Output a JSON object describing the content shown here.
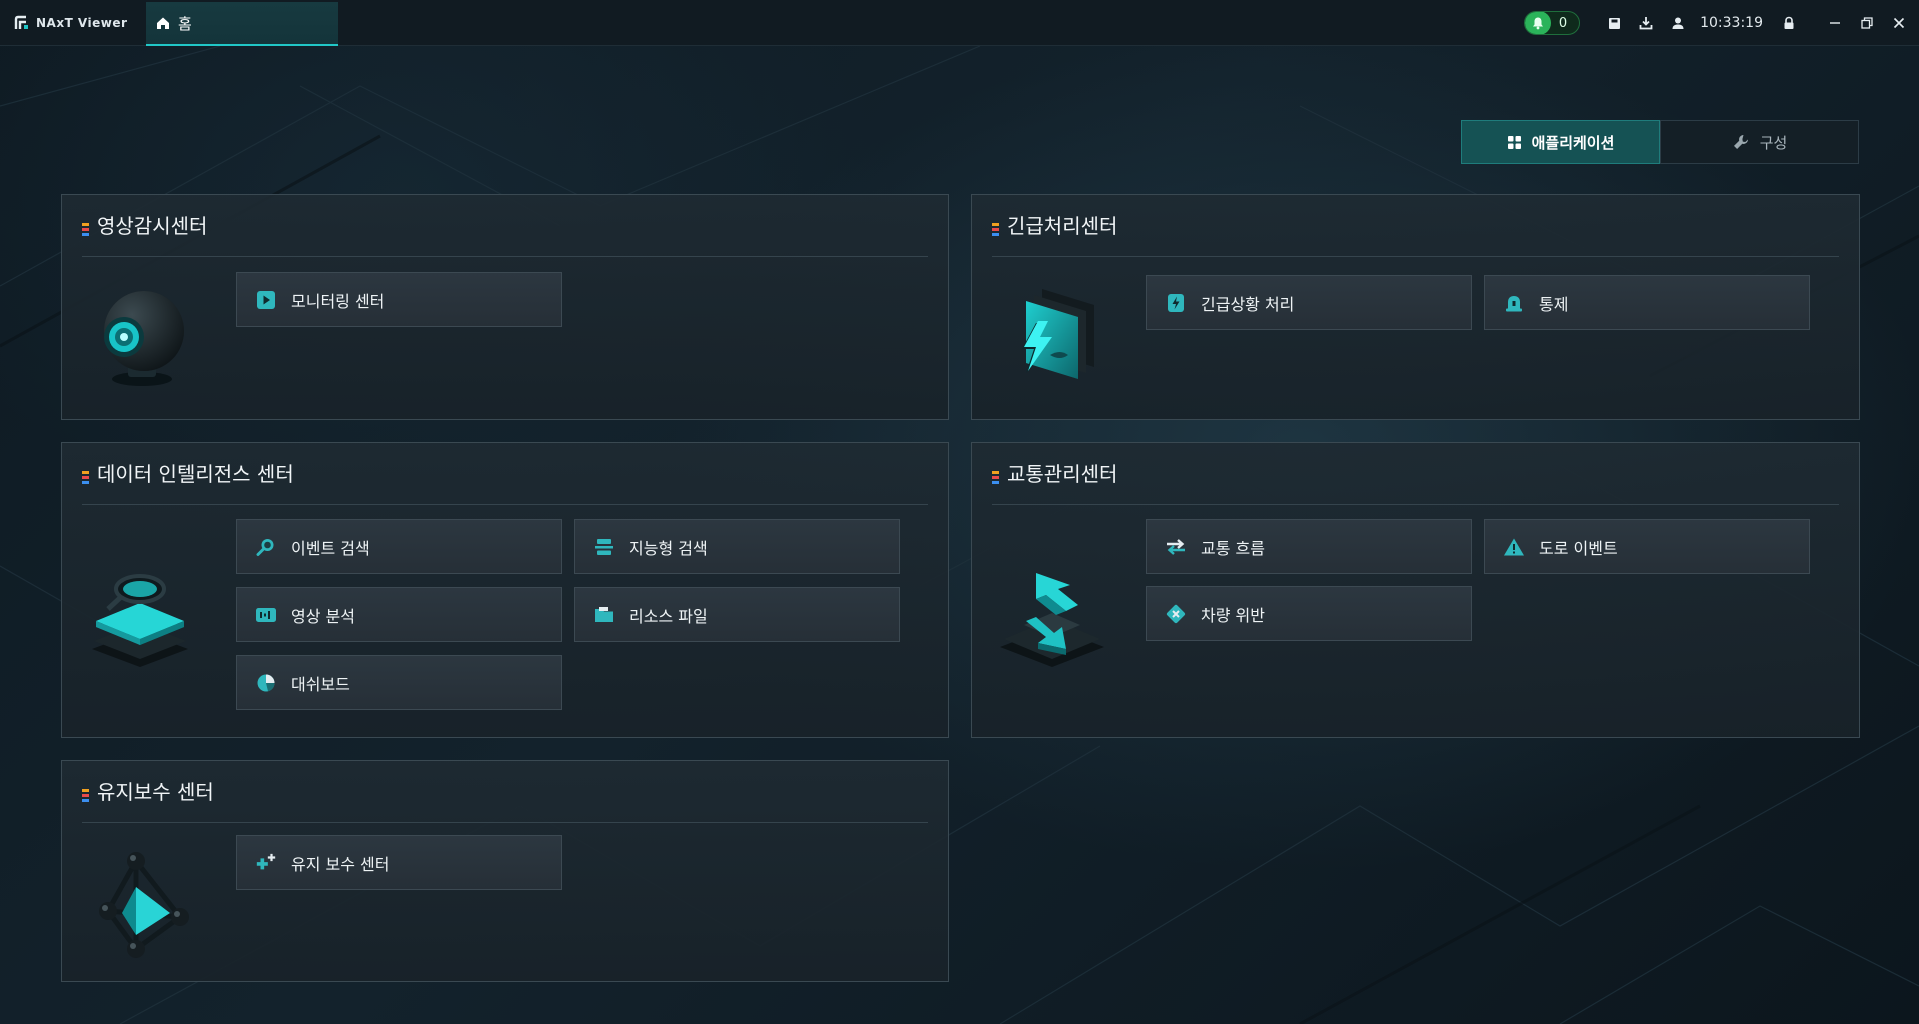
{
  "app": {
    "title": "NAxT Viewer"
  },
  "tabs": [
    {
      "label": "홈"
    }
  ],
  "header": {
    "notifications": {
      "count": "0"
    },
    "time": "10:33:19"
  },
  "view_toggle": {
    "applications_label": "애플리케이션",
    "config_label": "구성"
  },
  "colors": {
    "accent": "#21c7c7",
    "accent_bar": [
      "#f0a020",
      "#e84a4a",
      "#3b8ff0"
    ]
  },
  "panels": {
    "video": {
      "title": "영상감시센터",
      "items": [
        {
          "label": "모니터링 센터",
          "icon": "play-icon"
        }
      ]
    },
    "emergency": {
      "title": "긴급처리센터",
      "items": [
        {
          "label": "긴급상황 처리",
          "icon": "lightning-icon"
        },
        {
          "label": "통제",
          "icon": "siren-icon"
        }
      ]
    },
    "data": {
      "title": "데이터 인텔리전스 센터",
      "items": [
        {
          "label": "이벤트 검색",
          "icon": "search-icon"
        },
        {
          "label": "지능형 검색",
          "icon": "scanner-icon"
        },
        {
          "label": "영상 분석",
          "icon": "video-analysis-icon"
        },
        {
          "label": "리소스 파일",
          "icon": "folder-icon"
        },
        {
          "label": "대쉬보드",
          "icon": "pie-chart-icon"
        }
      ]
    },
    "traffic": {
      "title": "교통관리센터",
      "items": [
        {
          "label": "교통 흐름",
          "icon": "arrows-exchange-icon"
        },
        {
          "label": "도로 이벤트",
          "icon": "warning-icon"
        },
        {
          "label": "차량 위반",
          "icon": "violation-icon"
        }
      ]
    },
    "maintenance": {
      "title": "유지보수 센터",
      "items": [
        {
          "label": "유지 보수 센터",
          "icon": "tools-plus-icon"
        }
      ]
    }
  }
}
